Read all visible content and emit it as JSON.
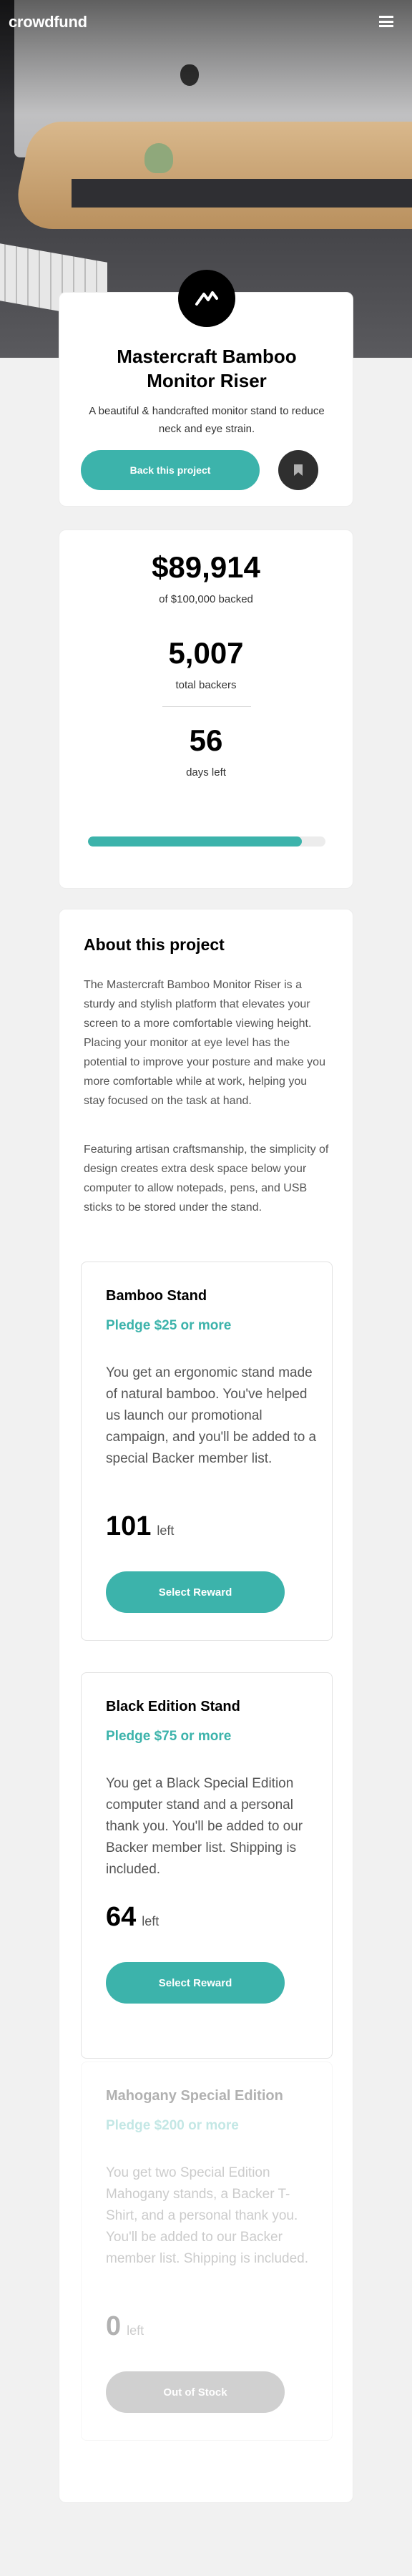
{
  "header": {
    "logo": "crowdfund"
  },
  "icons": {
    "menu": "hamburger-icon",
    "bookmark": "bookmark-icon",
    "project_logo": "mastercraft-logo-icon"
  },
  "colors": {
    "accent": "#3cb3ab",
    "dark": "#2f2f2f"
  },
  "project": {
    "title": "Mastercraft Bamboo Monitor Riser",
    "description": "A beautiful & handcrafted monitor stand to reduce neck and eye strain.",
    "back_label": "Back this project"
  },
  "stats": {
    "backed_amount": "$89,914",
    "backed_label": "of $100,000 backed",
    "backers": "5,007",
    "backers_label": "total backers",
    "days": "56",
    "days_label": "days left",
    "progress": 0.8991
  },
  "about": {
    "title": "About this project",
    "paragraph1": "The Mastercraft Bamboo Monitor Riser is a sturdy and stylish platform that elevates your screen to a more comfortable viewing height. Placing your monitor at eye level has the potential to improve your posture and make you more comfortable while at work, helping you stay focused on the task at hand.",
    "paragraph2": "Featuring artisan craftsmanship, the simplicity of design creates extra desk space below your computer to allow notepads, pens, and USB sticks to be stored under the stand."
  },
  "rewards": [
    {
      "title": "Bamboo Stand",
      "pledge": "Pledge $25 or more",
      "description": "You get an ergonomic stand made of natural bamboo. You've helped us launch our promotional campaign, and you'll be added to a special Backer member list.",
      "left": "101",
      "left_label": "left",
      "button": "Select Reward"
    },
    {
      "title": "Black Edition Stand",
      "pledge": "Pledge $75 or more",
      "description": "You get a Black Special Edition computer stand and a personal thank you. You'll be added to our Backer member list. Shipping is included.",
      "left": "64",
      "left_label": "left",
      "button": "Select Reward"
    },
    {
      "title": "Mahogany Special Edition",
      "pledge": "Pledge $200 or more",
      "description": "You get two Special Edition Mahogany stands, a Backer T-Shirt, and a personal thank you. You'll be added to our Backer member list. Shipping is included.",
      "left": "0",
      "left_label": "left",
      "button": "Out of Stock"
    }
  ]
}
